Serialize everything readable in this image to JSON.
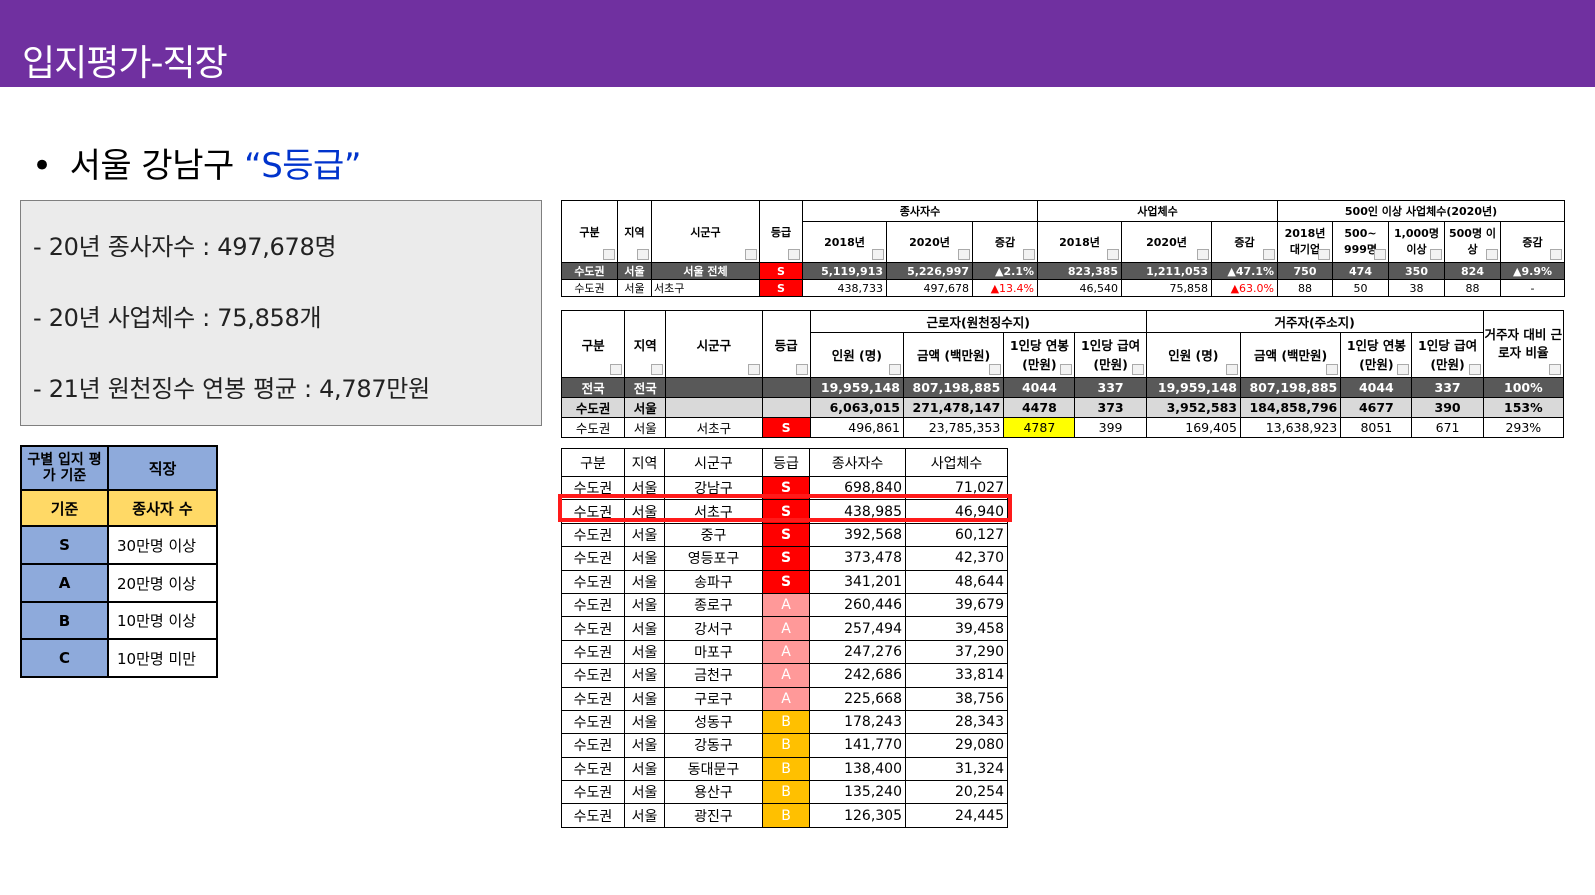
{
  "page": {
    "title": "입지평가-직장",
    "headline_bullet": "•",
    "headline_prefix": "서울 강남구 ",
    "headline_accent": "“S등급”",
    "colors": {
      "title_bar": "#7030a0",
      "accent": "#0033cc",
      "grade_S": "#ff0000",
      "grade_A": "#ff9999",
      "grade_B": "#ffc000",
      "highlight": "#ff1a1a"
    }
  },
  "summary": [
    "- 20년 종사자수 : 497,678명",
    "- 20년 사업체수 : 75,858개",
    "- 21년 원천징수 연봉 평균 : 4,787만원"
  ],
  "criteria": {
    "header_left": "구별 입지 평가 기준",
    "header_right": "직장",
    "basis_left": "기준",
    "basis_right": "종사자 수",
    "rows": [
      {
        "grade": "S",
        "text": "30만명 이상"
      },
      {
        "grade": "A",
        "text": "20만명 이상"
      },
      {
        "grade": "B",
        "text": "10만명 이상"
      },
      {
        "grade": "C",
        "text": "10만명 미만"
      }
    ]
  },
  "table1": {
    "h_gubun": "구분",
    "h_region": "지역",
    "h_district": "시군구",
    "h_grade": "등급",
    "g_workers": "종사자수",
    "g_biz": "사업체수",
    "g_large": "500인 이상 사업체수(2020년)",
    "h_2018": "2018년",
    "h_2020": "2020년",
    "h_change": "증감",
    "h_large1": "2018년 대기업",
    "h_large2": "500~ 999명",
    "h_large3": "1,000명 이상",
    "h_large4": "500명 이상",
    "h_large5": "증감",
    "rows": [
      [
        "수도권",
        "서울",
        "서울 전체",
        "S",
        "5,119,913",
        "5,226,997",
        "▲2.1%",
        "823,385",
        "1,211,053",
        "▲47.1%",
        "750",
        "474",
        "350",
        "824",
        "▲9.9%"
      ],
      [
        "수도권",
        "서울",
        "서초구",
        "S",
        "438,733",
        "497,678",
        "▲13.4%",
        "46,540",
        "75,858",
        "▲63.0%",
        "88",
        "50",
        "38",
        "88",
        "-"
      ]
    ]
  },
  "table2": {
    "h_gubun": "구분",
    "h_region": "지역",
    "h_district": "시군구",
    "h_grade": "등급",
    "g_workers": "근로자(원천징수지)",
    "g_residents": "거주자(주소지)",
    "h_ratio": "거주자 대비 근로자 비율",
    "h_people": "인원 (명)",
    "h_amount": "금액 (백만원)",
    "h_salary": "1인당 연봉 (만원)",
    "h_pay": "1인당 급여 (만원)",
    "rows": [
      [
        "전국",
        "전국",
        "",
        "",
        "19,959,148",
        "807,198,885",
        "4044",
        "337",
        "19,959,148",
        "807,198,885",
        "4044",
        "337",
        "100%"
      ],
      [
        "수도권",
        "서울",
        "",
        "",
        "6,063,015",
        "271,478,147",
        "4478",
        "373",
        "3,952,583",
        "184,858,796",
        "4677",
        "390",
        "153%"
      ],
      [
        "수도권",
        "서울",
        "서초구",
        "S",
        "496,861",
        "23,785,353",
        "4787",
        "399",
        "169,405",
        "13,638,923",
        "8051",
        "671",
        "293%"
      ]
    ]
  },
  "table3": {
    "headers": [
      "구분",
      "지역",
      "시군구",
      "등급",
      "종사자수",
      "사업체수"
    ],
    "rows": [
      [
        "수도권",
        "서울",
        "강남구",
        "S",
        "698,840",
        "71,027"
      ],
      [
        "수도권",
        "서울",
        "서초구",
        "S",
        "438,985",
        "46,940"
      ],
      [
        "수도권",
        "서울",
        "중구",
        "S",
        "392,568",
        "60,127"
      ],
      [
        "수도권",
        "서울",
        "영등포구",
        "S",
        "373,478",
        "42,370"
      ],
      [
        "수도권",
        "서울",
        "송파구",
        "S",
        "341,201",
        "48,644"
      ],
      [
        "수도권",
        "서울",
        "종로구",
        "A",
        "260,446",
        "39,679"
      ],
      [
        "수도권",
        "서울",
        "강서구",
        "A",
        "257,494",
        "39,458"
      ],
      [
        "수도권",
        "서울",
        "마포구",
        "A",
        "247,276",
        "37,290"
      ],
      [
        "수도권",
        "서울",
        "금천구",
        "A",
        "242,686",
        "33,814"
      ],
      [
        "수도권",
        "서울",
        "구로구",
        "A",
        "225,668",
        "38,756"
      ],
      [
        "수도권",
        "서울",
        "성동구",
        "B",
        "178,243",
        "28,343"
      ],
      [
        "수도권",
        "서울",
        "강동구",
        "B",
        "141,770",
        "29,080"
      ],
      [
        "수도권",
        "서울",
        "동대문구",
        "B",
        "138,400",
        "31,324"
      ],
      [
        "수도권",
        "서울",
        "용산구",
        "B",
        "135,240",
        "20,254"
      ],
      [
        "수도권",
        "서울",
        "광진구",
        "B",
        "126,305",
        "24,445"
      ]
    ]
  }
}
